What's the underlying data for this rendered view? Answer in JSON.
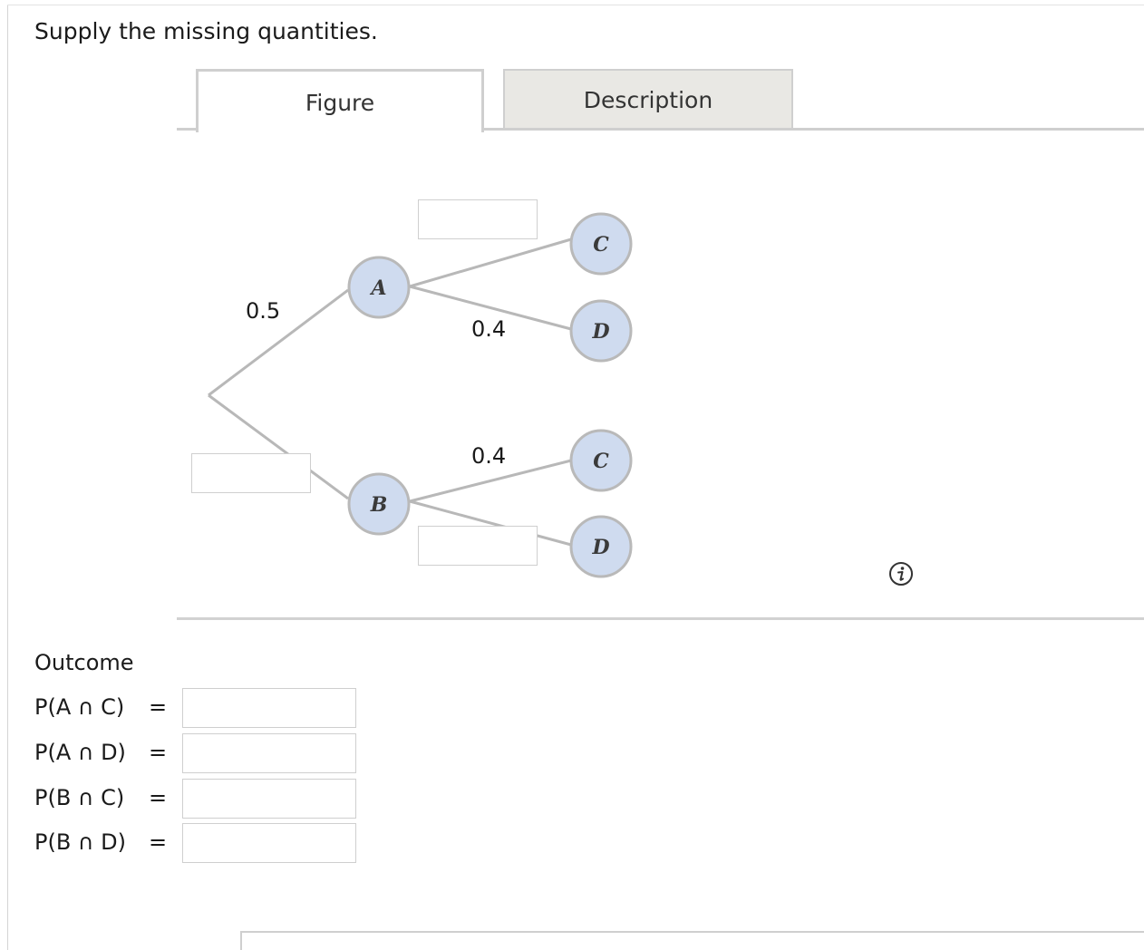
{
  "instruction": "Supply the missing quantities.",
  "tabs": {
    "figure": "Figure",
    "description": "Description"
  },
  "tree": {
    "nodes": {
      "A": "A",
      "B": "B",
      "A_C": "C",
      "A_D": "D",
      "B_C": "C",
      "B_D": "D"
    },
    "probabilities": {
      "root_to_A": "0.5",
      "root_to_B": "",
      "A_to_C": "",
      "A_to_D": "0.4",
      "B_to_C": "0.4",
      "B_to_D": ""
    },
    "node_fill_color": "#cfdbef",
    "branch_color": "#b8b8b8"
  },
  "info_icon": "info-icon",
  "outcome": {
    "title": "Outcome",
    "rows": [
      {
        "expr": "P(A ∩ C)",
        "eq": "=",
        "value": ""
      },
      {
        "expr": "P(A ∩ D)",
        "eq": "=",
        "value": ""
      },
      {
        "expr": "P(B ∩ C)",
        "eq": "=",
        "value": ""
      },
      {
        "expr": "P(B ∩ D)",
        "eq": "=",
        "value": ""
      }
    ]
  }
}
